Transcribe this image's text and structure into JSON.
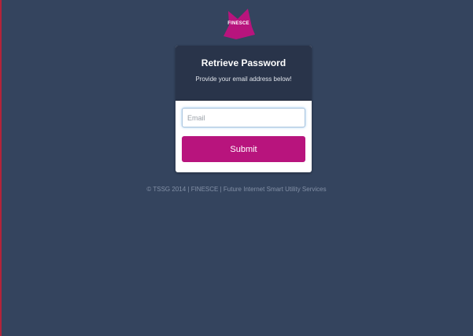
{
  "logo": {
    "text": "FINESCE",
    "color": "#b8147d"
  },
  "card": {
    "title": "Retrieve Password",
    "subtitle": "Provide your email address below!"
  },
  "form": {
    "email_placeholder": "Email",
    "email_value": "",
    "submit_label": "Submit"
  },
  "footer": {
    "text": "© TSSG 2014 | FINESCE | Future Internet Smart Utility Services"
  },
  "colors": {
    "background": "#34445e",
    "header": "#29344a",
    "accent": "#b8147d"
  }
}
